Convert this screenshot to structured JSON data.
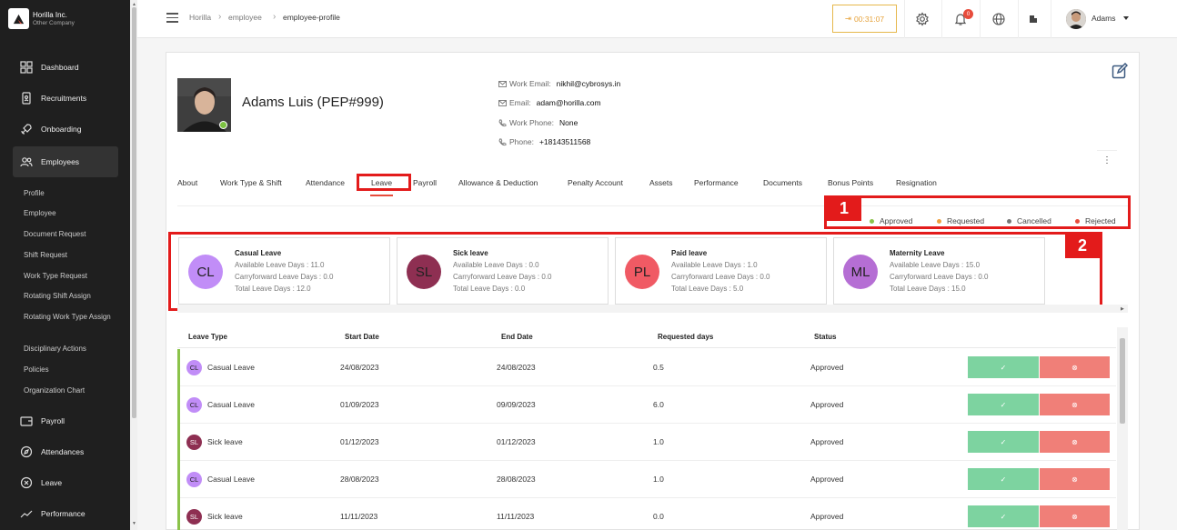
{
  "company": {
    "name": "Horilla Inc.",
    "sub": "Other Company"
  },
  "sidebar": {
    "items": [
      {
        "label": "Dashboard",
        "icon": "dashboard-icon"
      },
      {
        "label": "Recruitments",
        "icon": "recruitment-icon"
      },
      {
        "label": "Onboarding",
        "icon": "rocket-icon"
      },
      {
        "label": "Employees",
        "icon": "users-icon"
      },
      {
        "label": "Payroll",
        "icon": "wallet-icon"
      },
      {
        "label": "Attendances",
        "icon": "compass-icon"
      },
      {
        "label": "Leave",
        "icon": "leave-icon"
      },
      {
        "label": "Performance",
        "icon": "chart-line-icon"
      }
    ],
    "subitems": [
      "Profile",
      "Employee",
      "Document Request",
      "Shift Request",
      "Work Type Request",
      "Rotating Shift Assign",
      "Rotating Work Type Assign",
      "Disciplinary Actions",
      "Policies",
      "Organization Chart"
    ]
  },
  "topbar": {
    "breadcrumb": [
      "Horilla",
      "employee",
      "employee-profile"
    ],
    "timer": "00:31:07",
    "notif_count": "0",
    "user": "Adams"
  },
  "profile": {
    "name": "Adams Luis (PEP#999)",
    "work_email_label": "Work Email:",
    "work_email": "nikhil@cybrosys.in",
    "email_label": "Email:",
    "email": "adam@horilla.com",
    "work_phone_label": "Work Phone:",
    "work_phone": "None",
    "phone_label": "Phone:",
    "phone": "+18143511568"
  },
  "tabs": [
    "About",
    "Work Type & Shift",
    "Attendance",
    "Leave",
    "Payroll",
    "Allowance & Deduction",
    "Penalty Account",
    "Assets",
    "Performance",
    "Documents",
    "Bonus Points",
    "Resignation"
  ],
  "active_tab": "Leave",
  "annotations": [
    "1",
    "2"
  ],
  "legend": [
    {
      "label": "Approved",
      "color": "#8bc34a"
    },
    {
      "label": "Requested",
      "color": "#f0a040"
    },
    {
      "label": "Cancelled",
      "color": "#777777"
    },
    {
      "label": "Rejected",
      "color": "#e74c3c"
    }
  ],
  "leave_cards": [
    {
      "abbr": "CL",
      "title": "Casual Leave",
      "available": "Available Leave Days : 11.0",
      "carry": "Carryforward Leave Days : 0.0",
      "total": "Total Leave Days : 12.0",
      "color": "#c18df7"
    },
    {
      "abbr": "SL",
      "title": "Sick leave",
      "available": "Available Leave Days : 0.0",
      "carry": "Carryforward Leave Days : 0.0",
      "total": "Total Leave Days : 0.0",
      "color": "#8e2f52"
    },
    {
      "abbr": "PL",
      "title": "Paid leave",
      "available": "Available Leave Days : 1.0",
      "carry": "Carryforward Leave Days : 0.0",
      "total": "Total Leave Days : 5.0",
      "color": "#f05a64"
    },
    {
      "abbr": "ML",
      "title": "Maternity Leave",
      "available": "Available Leave Days : 15.0",
      "carry": "Carryforward Leave Days : 0.0",
      "total": "Total Leave Days : 15.0",
      "color": "#b56ed4"
    }
  ],
  "table": {
    "headers": [
      "Leave Type",
      "Start Date",
      "End Date",
      "Requested days",
      "Status"
    ],
    "rows": [
      {
        "abbr": "CL",
        "type": "Casual Leave",
        "start": "24/08/2023",
        "end": "24/08/2023",
        "days": "0.5",
        "status": "Approved"
      },
      {
        "abbr": "CL",
        "type": "Casual Leave",
        "start": "01/09/2023",
        "end": "09/09/2023",
        "days": "6.0",
        "status": "Approved"
      },
      {
        "abbr": "SL",
        "type": "Sick leave",
        "start": "01/12/2023",
        "end": "01/12/2023",
        "days": "1.0",
        "status": "Approved"
      },
      {
        "abbr": "CL",
        "type": "Casual Leave",
        "start": "28/08/2023",
        "end": "28/08/2023",
        "days": "1.0",
        "status": "Approved"
      },
      {
        "abbr": "SL",
        "type": "Sick leave",
        "start": "11/11/2023",
        "end": "11/11/2023",
        "days": "0.0",
        "status": "Approved"
      }
    ]
  }
}
